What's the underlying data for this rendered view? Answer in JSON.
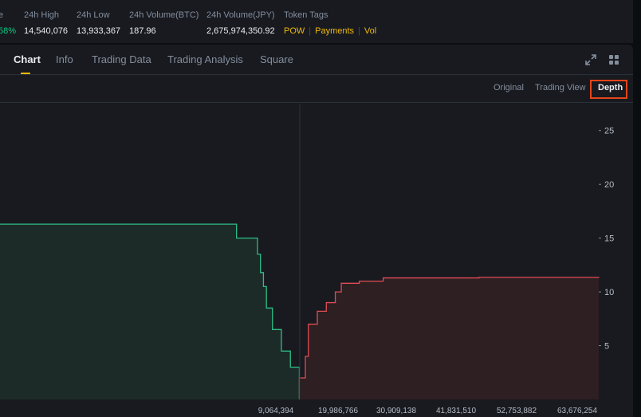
{
  "stats": [
    {
      "label": "e",
      "value": "58%",
      "positive": true
    },
    {
      "label": "24h High",
      "value": "14,540,076"
    },
    {
      "label": "24h Low",
      "value": "13,933,367"
    },
    {
      "label": "24h Volume(BTC)",
      "value": "187.96"
    },
    {
      "label": "24h Volume(JPY)",
      "value": "2,675,974,350.92"
    }
  ],
  "token_tags": {
    "label": "Token Tags",
    "tags": [
      "POW",
      "Payments",
      "Vol"
    ]
  },
  "tabs": [
    {
      "label": "Chart",
      "active": true
    },
    {
      "label": "Info"
    },
    {
      "label": "Trading Data"
    },
    {
      "label": "Trading Analysis"
    },
    {
      "label": "Square"
    }
  ],
  "toolbar": {
    "icons": [
      "expand-icon",
      "grid-layout-icon"
    ]
  },
  "view_modes": [
    {
      "label": "Original"
    },
    {
      "label": "Trading View"
    },
    {
      "label": "Depth",
      "active": true
    }
  ],
  "colors": {
    "bid": "#2ebd85",
    "bid_fill": "#1c2b28",
    "ask": "#e04d55",
    "ask_fill": "#2e1f22",
    "accent": "#f0b90b",
    "highlight_box": "#e5451b"
  },
  "chart_data": {
    "type": "area",
    "x_tick_labels": [
      "9,064,394",
      "19,986,766",
      "30,909,138",
      "41,831,510",
      "52,753,882",
      "63,676,254"
    ],
    "y_ticks": [
      5,
      10,
      15,
      20,
      25
    ],
    "ylim": [
      0,
      27.5
    ],
    "series": [
      {
        "side": "bid",
        "points": [
          [
            0,
            16.3
          ],
          [
            0.39,
            16.3
          ],
          [
            0.395,
            15.0
          ],
          [
            0.425,
            15.0
          ],
          [
            0.43,
            13.5
          ],
          [
            0.435,
            11.8
          ],
          [
            0.44,
            10.5
          ],
          [
            0.445,
            8.5
          ],
          [
            0.455,
            6.5
          ],
          [
            0.47,
            4.5
          ],
          [
            0.485,
            3.0
          ],
          [
            0.5,
            2.2
          ],
          [
            0.5,
            0
          ]
        ]
      },
      {
        "side": "ask",
        "points": [
          [
            0.5,
            0
          ],
          [
            0.5,
            2.0
          ],
          [
            0.51,
            4.0
          ],
          [
            0.515,
            7.0
          ],
          [
            0.53,
            8.2
          ],
          [
            0.545,
            9.0
          ],
          [
            0.56,
            10.0
          ],
          [
            0.57,
            10.8
          ],
          [
            0.6,
            11.0
          ],
          [
            0.64,
            11.3
          ],
          [
            0.8,
            11.35
          ],
          [
            1.0,
            11.4
          ]
        ]
      }
    ]
  }
}
